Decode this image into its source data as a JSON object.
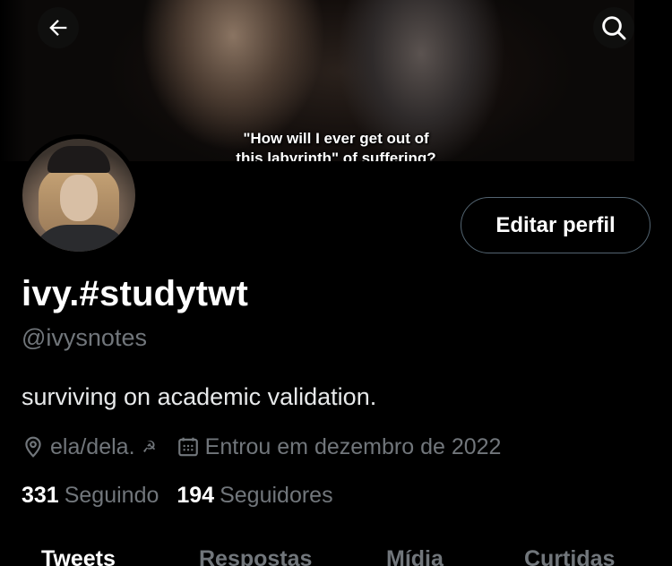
{
  "header": {
    "banner_caption_line1": "\"How will I ever get out of",
    "banner_caption_line2": "this labyrinth\" of suffering?",
    "back_icon": "arrow-left-icon",
    "search_icon": "search-icon"
  },
  "profile": {
    "edit_label": "Editar perfil",
    "display_name": "ivy.#studytwt",
    "handle": "@ivysnotes",
    "bio": "surviving on academic validation.",
    "location": "ela/dela.",
    "location_symbol": "☭",
    "joined": "Entrou em dezembro de 2022"
  },
  "stats": {
    "following_count": "331",
    "following_label": "Seguindo",
    "followers_count": "194",
    "followers_label": "Seguidores"
  },
  "tabs": [
    {
      "label": "Tweets",
      "active": true
    },
    {
      "label": "Respostas",
      "active": false
    },
    {
      "label": "Mídia",
      "active": false
    },
    {
      "label": "Curtidas",
      "active": false
    }
  ],
  "colors": {
    "background": "#000000",
    "primary_text": "#e7e9ea",
    "secondary_text": "#71767b",
    "border": "#536471"
  }
}
